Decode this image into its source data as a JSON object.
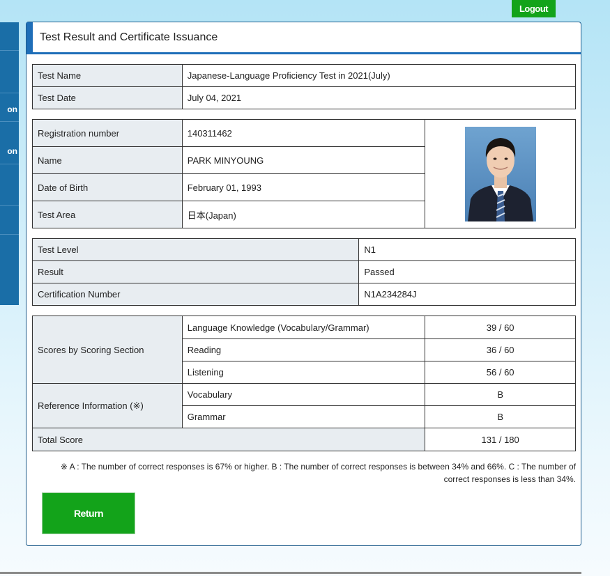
{
  "header": {
    "logout_label": "Logout"
  },
  "sidebar": {
    "items": [
      {
        "label": ""
      },
      {
        "label": "on"
      },
      {
        "label": "on"
      },
      {
        "label": ""
      },
      {
        "label": ""
      },
      {
        "label": ""
      }
    ]
  },
  "page": {
    "title": "Test Result and Certificate Issuance"
  },
  "test_info": {
    "test_name_label": "Test Name",
    "test_name_value": "Japanese-Language Proficiency Test in 2021(July)",
    "test_date_label": "Test Date",
    "test_date_value": "July 04, 2021"
  },
  "examinee": {
    "reg_label": "Registration number",
    "reg_value": "140311462",
    "name_label": "Name",
    "name_value": "PARK MINYOUNG",
    "dob_label": "Date of Birth",
    "dob_value": "February 01, 1993",
    "area_label": "Test Area",
    "area_value": "日本(Japan)"
  },
  "result": {
    "level_label": "Test Level",
    "level_value": "N1",
    "result_label": "Result",
    "result_value": "Passed",
    "cert_label": "Certification Number",
    "cert_value": "N1A234284J"
  },
  "scores": {
    "section_label": "Scores by Scoring Section",
    "sections": [
      {
        "name": "Language Knowledge (Vocabulary/Grammar)",
        "score": "39 / 60"
      },
      {
        "name": "Reading",
        "score": "36 / 60"
      },
      {
        "name": "Listening",
        "score": "56 / 60"
      }
    ],
    "reference_label": "Reference Information (※)",
    "references": [
      {
        "name": "Vocabulary",
        "grade": "B"
      },
      {
        "name": "Grammar",
        "grade": "B"
      }
    ],
    "total_label": "Total Score",
    "total_value": "131 / 180"
  },
  "note": {
    "text": "※ A : The number of correct responses is 67% or higher.  B : The number of correct responses is between 34% and 66%.  C : The number of correct responses is less than 34%."
  },
  "actions": {
    "return_label": "Return"
  }
}
